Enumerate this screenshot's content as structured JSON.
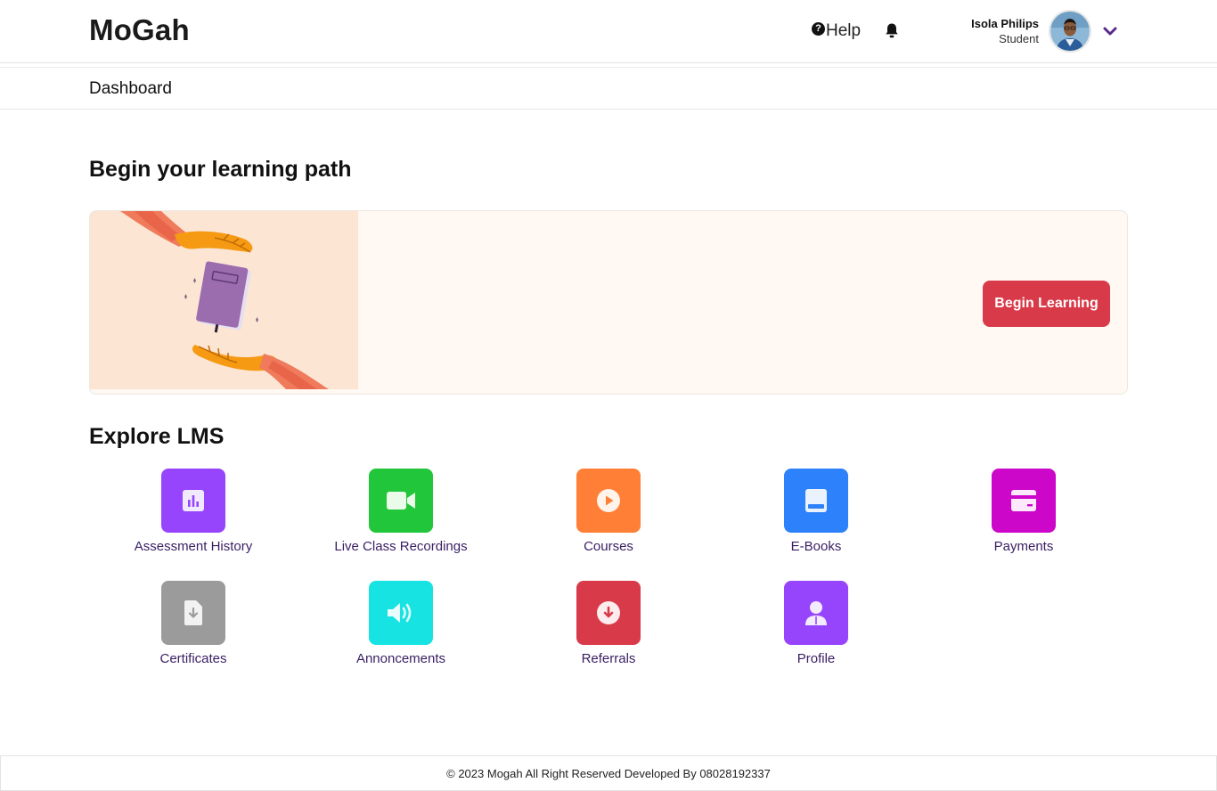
{
  "header": {
    "logo": "MoGah",
    "help_label": "Help",
    "user": {
      "name": "Isola Philips",
      "role": "Student"
    }
  },
  "breadcrumb": "Dashboard",
  "learning": {
    "title": "Begin your learning path",
    "button_label": "Begin Learning"
  },
  "explore": {
    "title": "Explore LMS",
    "tiles": [
      {
        "label": "Assessment History",
        "icon": "bar-chart-icon",
        "color": "#9745fd"
      },
      {
        "label": "Live Class Recordings",
        "icon": "video-camera-icon",
        "color": "#22c63a"
      },
      {
        "label": "Courses",
        "icon": "play-icon",
        "color": "#ff7f36"
      },
      {
        "label": "E-Books",
        "icon": "book-icon",
        "color": "#2d82fb"
      },
      {
        "label": "Payments",
        "icon": "credit-card-icon",
        "color": "#cc07c9"
      },
      {
        "label": "Certificates",
        "icon": "file-download-icon",
        "color": "#9b9b9b"
      },
      {
        "label": "Annoncements",
        "icon": "speaker-icon",
        "color": "#17e3e3"
      },
      {
        "label": "Referrals",
        "icon": "download-circle-icon",
        "color": "#d93a49"
      },
      {
        "label": "Profile",
        "icon": "user-icon",
        "color": "#9745fd"
      }
    ]
  },
  "footer": {
    "text": "© 2023 Mogah All Right Reserved Developed By 08028192337"
  },
  "colors": {
    "accent": "#d93a49",
    "label": "#3a1e63",
    "chevron": "#5a2a8a"
  }
}
